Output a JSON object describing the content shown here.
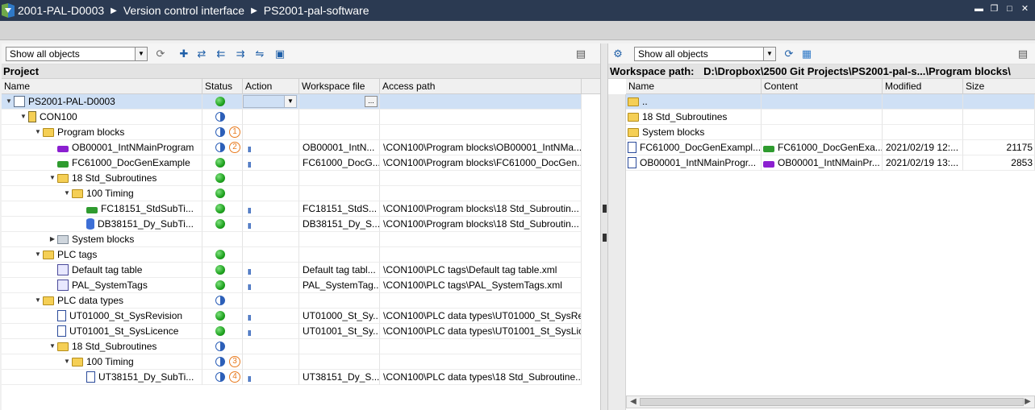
{
  "title": {
    "breadcrumb": [
      "2001-PAL-D0003",
      "Version control interface",
      "PS2001-pal-software"
    ],
    "window_controls": [
      "minimize",
      "restore",
      "maximize",
      "close"
    ]
  },
  "left": {
    "filter": "Show all objects",
    "section": "Project",
    "columns": [
      "Name",
      "Status",
      "Action",
      "Workspace file",
      "Access path"
    ],
    "rows": [
      {
        "name": "PS2001-PAL-D0003",
        "icon": "plc-project-icon",
        "twisty": "▼",
        "status": "green",
        "badge": "",
        "action": "dropdown",
        "ws": "",
        "path": "",
        "browse": true
      },
      {
        "name": "CON100",
        "icon": "cpu-icon",
        "twisty": "▼",
        "status": "half",
        "badge": "",
        "action": "",
        "ws": "",
        "path": ""
      },
      {
        "name": "Program blocks",
        "icon": "folder-icon",
        "twisty": "▼",
        "status": "half",
        "badge": "1",
        "action": "",
        "ws": "",
        "path": ""
      },
      {
        "name": "OB00001_IntNMainProgram",
        "icon": "ob-icon",
        "twisty": "",
        "status": "warn",
        "badge": "2",
        "action": "II",
        "ws": "OB00001_IntN...",
        "path": "\\CON100\\Program blocks\\OB00001_IntNMa..."
      },
      {
        "name": "FC61000_DocGenExample",
        "icon": "fc-icon",
        "twisty": "",
        "status": "green",
        "badge": "",
        "action": "II",
        "ws": "FC61000_DocG...",
        "path": "\\CON100\\Program blocks\\FC61000_DocGen..."
      },
      {
        "name": "18 Std_Subroutines",
        "icon": "folder-icon",
        "twisty": "▼",
        "status": "green",
        "badge": "",
        "action": "",
        "ws": "",
        "path": ""
      },
      {
        "name": "100 Timing",
        "icon": "folder-icon",
        "twisty": "▼",
        "status": "green",
        "badge": "",
        "action": "",
        "ws": "",
        "path": ""
      },
      {
        "name": "FC18151_StdSubTi...",
        "icon": "fc-icon",
        "twisty": "",
        "status": "green",
        "badge": "",
        "action": "II",
        "ws": "FC18151_StdS...",
        "path": "\\CON100\\Program blocks\\18 Std_Subroutin..."
      },
      {
        "name": "DB38151_Dy_SubTi...",
        "icon": "db-icon",
        "twisty": "",
        "status": "green",
        "badge": "",
        "action": "II",
        "ws": "DB38151_Dy_S...",
        "path": "\\CON100\\Program blocks\\18 Std_Subroutin..."
      },
      {
        "name": "System blocks",
        "icon": "system-folder-icon",
        "twisty": "▶",
        "status": "",
        "badge": "",
        "action": "",
        "ws": "",
        "path": ""
      },
      {
        "name": "PLC tags",
        "icon": "folder-icon",
        "twisty": "▼",
        "status": "green",
        "badge": "",
        "action": "",
        "ws": "",
        "path": ""
      },
      {
        "name": "Default tag table",
        "icon": "tag-table-icon",
        "twisty": "",
        "status": "green",
        "badge": "",
        "action": "II",
        "ws": "Default tag tabl...",
        "path": "\\CON100\\PLC tags\\Default tag table.xml"
      },
      {
        "name": "PAL_SystemTags",
        "icon": "tag-table-icon",
        "twisty": "",
        "status": "green",
        "badge": "",
        "action": "II",
        "ws": "PAL_SystemTag...",
        "path": "\\CON100\\PLC tags\\PAL_SystemTags.xml"
      },
      {
        "name": "PLC data types",
        "icon": "folder-icon",
        "twisty": "▼",
        "status": "half",
        "badge": "",
        "action": "",
        "ws": "",
        "path": ""
      },
      {
        "name": "UT01000_St_SysRevision",
        "icon": "udt-icon",
        "twisty": "",
        "status": "green",
        "badge": "",
        "action": "II",
        "ws": "UT01000_St_Sy...",
        "path": "\\CON100\\PLC data types\\UT01000_St_SysRe..."
      },
      {
        "name": "UT01001_St_SysLicence",
        "icon": "udt-icon",
        "twisty": "",
        "status": "green",
        "badge": "",
        "action": "II",
        "ws": "UT01001_St_Sy...",
        "path": "\\CON100\\PLC data types\\UT01001_St_SysLic..."
      },
      {
        "name": "18 Std_Subroutines",
        "icon": "folder-icon",
        "twisty": "▼",
        "status": "half",
        "badge": "",
        "action": "",
        "ws": "",
        "path": ""
      },
      {
        "name": "100 Timing",
        "icon": "folder-icon",
        "twisty": "▼",
        "status": "half",
        "badge": "3",
        "action": "",
        "ws": "",
        "path": ""
      },
      {
        "name": "UT38151_Dy_SubTi...",
        "icon": "udt-icon",
        "twisty": "",
        "status": "warn",
        "badge": "4",
        "action": "II",
        "ws": "UT38151_Dy_S...",
        "path": "\\CON100\\PLC data types\\18 Std_Subroutine..."
      }
    ]
  },
  "right": {
    "filter": "Show all objects",
    "workspace_label": "Workspace path:",
    "workspace_path": "D:\\Dropbox\\2500 Git Projects\\PS2001-pal-s...\\Program blocks\\",
    "columns": [
      "Name",
      "Content",
      "Modified",
      "Size"
    ],
    "rows": [
      {
        "name": "..",
        "icon": "folder-up-icon",
        "content": "",
        "content_icon": "",
        "modified": "",
        "size": "",
        "selected": true
      },
      {
        "name": "18 Std_Subroutines",
        "icon": "folder-icon",
        "content": "",
        "content_icon": "",
        "modified": "",
        "size": ""
      },
      {
        "name": "System blocks",
        "icon": "folder-icon",
        "content": "",
        "content_icon": "",
        "modified": "",
        "size": ""
      },
      {
        "name": "FC61000_DocGenExampl...",
        "icon": "xml-file-icon",
        "content": "FC61000_DocGenExa...",
        "content_icon": "fc-icon",
        "modified": "2021/02/19 12:...",
        "size": "21175"
      },
      {
        "name": "OB00001_IntNMainProgr...",
        "icon": "xml-file-icon",
        "content": "OB00001_IntNMainPr...",
        "content_icon": "ob-icon",
        "modified": "2021/02/19 13:...",
        "size": "2853"
      }
    ]
  }
}
